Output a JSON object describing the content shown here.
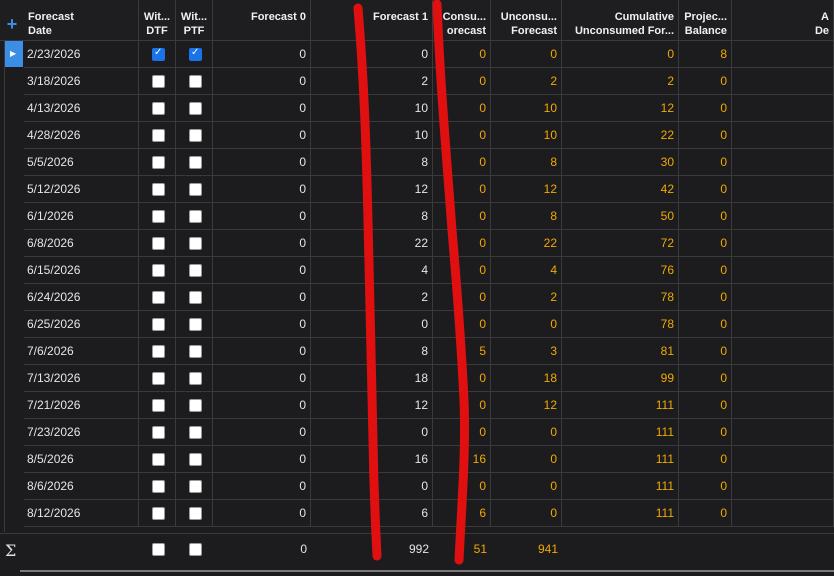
{
  "toolbar": {
    "add_label": "+",
    "sum_symbol": "Σ"
  },
  "columns": [
    {
      "key": "date",
      "label": "Forecast\nDate"
    },
    {
      "key": "dtf",
      "label": "Wit...\nDTF"
    },
    {
      "key": "ptf",
      "label": "Wit...\nPTF"
    },
    {
      "key": "f0",
      "label": "Forecast 0"
    },
    {
      "key": "f1",
      "label": "Forecast 1"
    },
    {
      "key": "consumed",
      "label": "Consu...\norecast"
    },
    {
      "key": "unconsumed",
      "label": "Unconsu...\nForecast"
    },
    {
      "key": "cumulative",
      "label": "Cumulative\nUnconsumed For..."
    },
    {
      "key": "projected",
      "label": "Projec...\nBalance"
    },
    {
      "key": "extra",
      "label": "A\nDe"
    }
  ],
  "rows": [
    {
      "date": "2/23/2026",
      "dtf": true,
      "ptf": true,
      "f0": "0",
      "f1": "0",
      "consumed": "0",
      "unconsumed": "0",
      "cumulative": "0",
      "projected": "8"
    },
    {
      "date": "3/18/2026",
      "dtf": false,
      "ptf": false,
      "f0": "0",
      "f1": "2",
      "consumed": "0",
      "unconsumed": "2",
      "cumulative": "2",
      "projected": "0"
    },
    {
      "date": "4/13/2026",
      "dtf": false,
      "ptf": false,
      "f0": "0",
      "f1": "10",
      "consumed": "0",
      "unconsumed": "10",
      "cumulative": "12",
      "projected": "0"
    },
    {
      "date": "4/28/2026",
      "dtf": false,
      "ptf": false,
      "f0": "0",
      "f1": "10",
      "consumed": "0",
      "unconsumed": "10",
      "cumulative": "22",
      "projected": "0"
    },
    {
      "date": "5/5/2026",
      "dtf": false,
      "ptf": false,
      "f0": "0",
      "f1": "8",
      "consumed": "0",
      "unconsumed": "8",
      "cumulative": "30",
      "projected": "0"
    },
    {
      "date": "5/12/2026",
      "dtf": false,
      "ptf": false,
      "f0": "0",
      "f1": "12",
      "consumed": "0",
      "unconsumed": "12",
      "cumulative": "42",
      "projected": "0"
    },
    {
      "date": "6/1/2026",
      "dtf": false,
      "ptf": false,
      "f0": "0",
      "f1": "8",
      "consumed": "0",
      "unconsumed": "8",
      "cumulative": "50",
      "projected": "0"
    },
    {
      "date": "6/8/2026",
      "dtf": false,
      "ptf": false,
      "f0": "0",
      "f1": "22",
      "consumed": "0",
      "unconsumed": "22",
      "cumulative": "72",
      "projected": "0"
    },
    {
      "date": "6/15/2026",
      "dtf": false,
      "ptf": false,
      "f0": "0",
      "f1": "4",
      "consumed": "0",
      "unconsumed": "4",
      "cumulative": "76",
      "projected": "0"
    },
    {
      "date": "6/24/2026",
      "dtf": false,
      "ptf": false,
      "f0": "0",
      "f1": "2",
      "consumed": "0",
      "unconsumed": "2",
      "cumulative": "78",
      "projected": "0"
    },
    {
      "date": "6/25/2026",
      "dtf": false,
      "ptf": false,
      "f0": "0",
      "f1": "0",
      "consumed": "0",
      "unconsumed": "0",
      "cumulative": "78",
      "projected": "0"
    },
    {
      "date": "7/6/2026",
      "dtf": false,
      "ptf": false,
      "f0": "0",
      "f1": "8",
      "consumed": "5",
      "unconsumed": "3",
      "cumulative": "81",
      "projected": "0"
    },
    {
      "date": "7/13/2026",
      "dtf": false,
      "ptf": false,
      "f0": "0",
      "f1": "18",
      "consumed": "0",
      "unconsumed": "18",
      "cumulative": "99",
      "projected": "0"
    },
    {
      "date": "7/21/2026",
      "dtf": false,
      "ptf": false,
      "f0": "0",
      "f1": "12",
      "consumed": "0",
      "unconsumed": "12",
      "cumulative": "111",
      "projected": "0"
    },
    {
      "date": "7/23/2026",
      "dtf": false,
      "ptf": false,
      "f0": "0",
      "f1": "0",
      "consumed": "0",
      "unconsumed": "0",
      "cumulative": "111",
      "projected": "0"
    },
    {
      "date": "8/5/2026",
      "dtf": false,
      "ptf": false,
      "f0": "0",
      "f1": "16",
      "consumed": "16",
      "unconsumed": "0",
      "cumulative": "111",
      "projected": "0"
    },
    {
      "date": "8/6/2026",
      "dtf": false,
      "ptf": false,
      "f0": "0",
      "f1": "0",
      "consumed": "0",
      "unconsumed": "0",
      "cumulative": "111",
      "projected": "0"
    },
    {
      "date": "8/12/2026",
      "dtf": false,
      "ptf": false,
      "f0": "0",
      "f1": "6",
      "consumed": "6",
      "unconsumed": "0",
      "cumulative": "111",
      "projected": "0"
    }
  ],
  "totals": {
    "dtf": false,
    "ptf": false,
    "f0": "0",
    "f1": "992",
    "consumed": "51",
    "unconsumed": "941"
  },
  "colors": {
    "accent": "#3a8ee6",
    "value_orange": "#f2a900",
    "annotation_red": "#e01010",
    "background": "#1c1c1e"
  }
}
